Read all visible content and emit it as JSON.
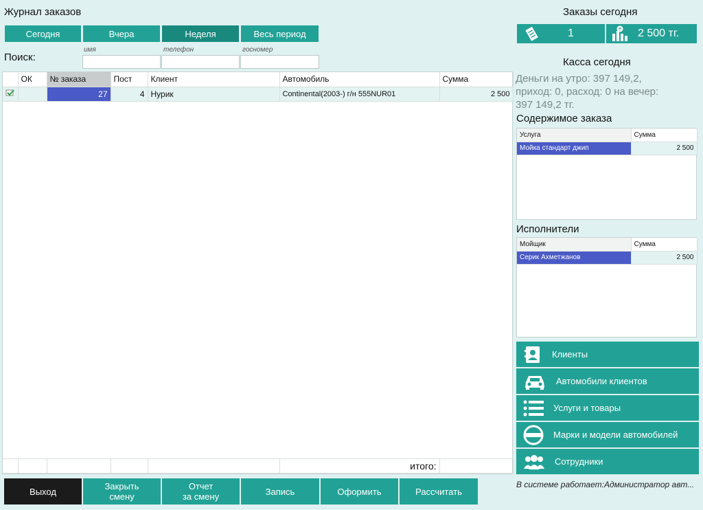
{
  "header": {
    "title": "Журнал заказов"
  },
  "periods": [
    "Сегодня",
    "Вчера",
    "Неделя",
    "Весь период"
  ],
  "search": {
    "label": "Поиск:",
    "name_label": "имя",
    "phone_label": "телефон",
    "plate_label": "госномер"
  },
  "columns": [
    "ОК",
    "№ заказа",
    "Пост",
    "Клиент",
    "Автомобиль",
    "Сумма"
  ],
  "orders": [
    {
      "number": "27",
      "post": "4",
      "client": "Нурик",
      "car": "Continental(2003-) г/н 555NUR01",
      "sum": "2 500"
    }
  ],
  "total_label": "итого:",
  "today": {
    "title": "Заказы сегодня",
    "count": "1",
    "sum": "2 500 тг."
  },
  "cash": {
    "title": "Касса сегодня",
    "line1": "Деньги на утро: 397 149,2,",
    "line2": "приход: 0, расход: 0 на вечер:",
    "line3": "397 149,2 тг."
  },
  "order_content": {
    "title": "Содержимое заказа",
    "col_service": "Услуга",
    "col_sum": "Сумма",
    "rows": [
      {
        "name": "Мойка стандарт джип",
        "sum": "2 500"
      }
    ]
  },
  "executors": {
    "title": "Исполнители",
    "col_worker": "Мойщик",
    "col_sum": "Сумма",
    "rows": [
      {
        "name": "Серик Ахметжанов",
        "sum": "2 500"
      }
    ]
  },
  "side_menu": [
    "Клиенты",
    "Автомобили клиентов",
    "Услуги и товары",
    "Марки и модели автомобилей",
    "Сотрудники"
  ],
  "bottom": {
    "exit": "Выход",
    "close_shift_1": "Закрыть",
    "close_shift_2": "смену",
    "report_1": "Отчет",
    "report_2": "за смену",
    "record": "Запись",
    "checkout": "Оформить",
    "calc": "Рассчитать"
  },
  "status": "В системе работает:Администратор авт...",
  "colors": {
    "teal": "#22a296",
    "selected_blue": "#4a5ac6",
    "background": "#dff1f1"
  }
}
